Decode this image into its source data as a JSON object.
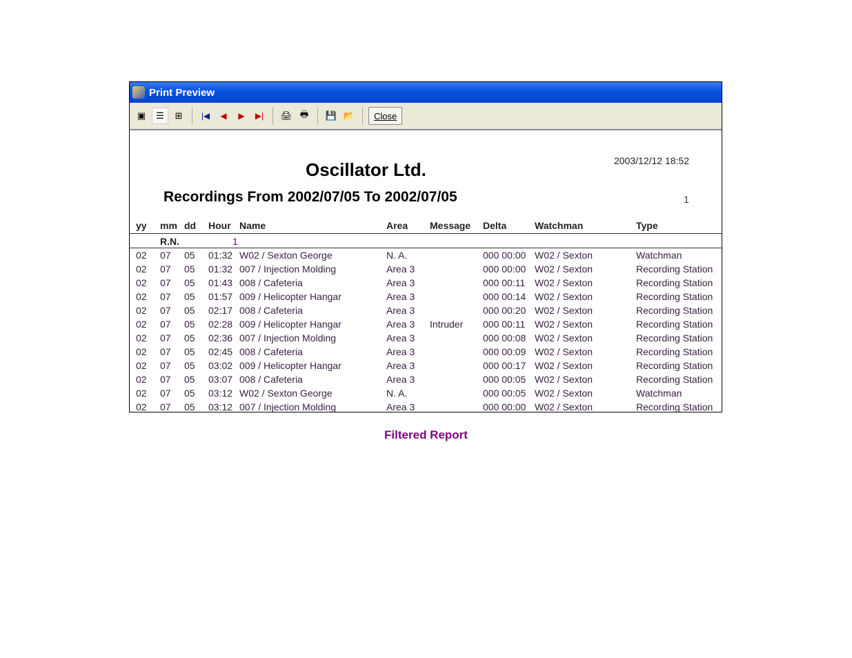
{
  "window": {
    "title": "Print Preview",
    "close_label": "Close"
  },
  "toolbar": {
    "icons": [
      "single-page-icon",
      "multi-page-icon",
      "page-width-icon",
      "first-page-icon",
      "previous-page-icon",
      "next-page-icon",
      "last-page-icon",
      "print-setup-icon",
      "print-icon",
      "save-icon",
      "open-icon"
    ]
  },
  "report": {
    "company": "Oscillator Ltd.",
    "subtitle": "Recordings From 2002/07/05 To 2002/07/05",
    "printed": "2003/12/12 18:52",
    "page": "1",
    "headers": {
      "yy": "yy",
      "mm": "mm",
      "dd": "dd",
      "hour": "Hour",
      "name": "Name",
      "area": "Area",
      "message": "Message",
      "delta": "Delta",
      "watchman": "Watchman",
      "type": "Type"
    },
    "rn_label": "R.N.",
    "rn_value": "1",
    "rows": [
      [
        "02",
        "07",
        "05",
        "01:32",
        "W02 / Sexton George",
        "N. A.",
        "",
        "000 00:00",
        "W02 / Sexton",
        "Watchman"
      ],
      [
        "02",
        "07",
        "05",
        "01:32",
        "007 / Injection Molding",
        "Area 3",
        "",
        "000 00:00",
        "W02 / Sexton",
        "Recording Station"
      ],
      [
        "02",
        "07",
        "05",
        "01:43",
        "008 / Cafeteria",
        "Area 3",
        "",
        "000 00:11",
        "W02 / Sexton",
        "Recording Station"
      ],
      [
        "02",
        "07",
        "05",
        "01:57",
        "009 / Helicopter Hangar",
        "Area 3",
        "",
        "000 00:14",
        "W02 / Sexton",
        "Recording Station"
      ],
      [
        "02",
        "07",
        "05",
        "02:17",
        "008 / Cafeteria",
        "Area 3",
        "",
        "000 00:20",
        "W02 / Sexton",
        "Recording Station"
      ],
      [
        "02",
        "07",
        "05",
        "02:28",
        "009 / Helicopter Hangar",
        "Area 3",
        "Intruder",
        "000 00:11",
        "W02 / Sexton",
        "Recording Station"
      ],
      [
        "02",
        "07",
        "05",
        "02:36",
        "007 / Injection Molding",
        "Area 3",
        "",
        "000 00:08",
        "W02 / Sexton",
        "Recording Station"
      ],
      [
        "02",
        "07",
        "05",
        "02:45",
        "008 / Cafeteria",
        "Area 3",
        "",
        "000 00:09",
        "W02 / Sexton",
        "Recording Station"
      ],
      [
        "02",
        "07",
        "05",
        "03:02",
        "009 / Helicopter Hangar",
        "Area 3",
        "",
        "000 00:17",
        "W02 / Sexton",
        "Recording Station"
      ],
      [
        "02",
        "07",
        "05",
        "03:07",
        "008 / Cafeteria",
        "Area 3",
        "",
        "000 00:05",
        "W02 / Sexton",
        "Recording Station"
      ],
      [
        "02",
        "07",
        "05",
        "03:12",
        "W02 / Sexton George",
        "N. A.",
        "",
        "000 00:05",
        "W02 / Sexton",
        "Watchman"
      ],
      [
        "02",
        "07",
        "05",
        "03:12",
        "007 / Injection Molding",
        "Area 3",
        "",
        "000 00:00",
        "W02 / Sexton",
        "Recording Station"
      ]
    ]
  },
  "caption": "Filtered Report"
}
